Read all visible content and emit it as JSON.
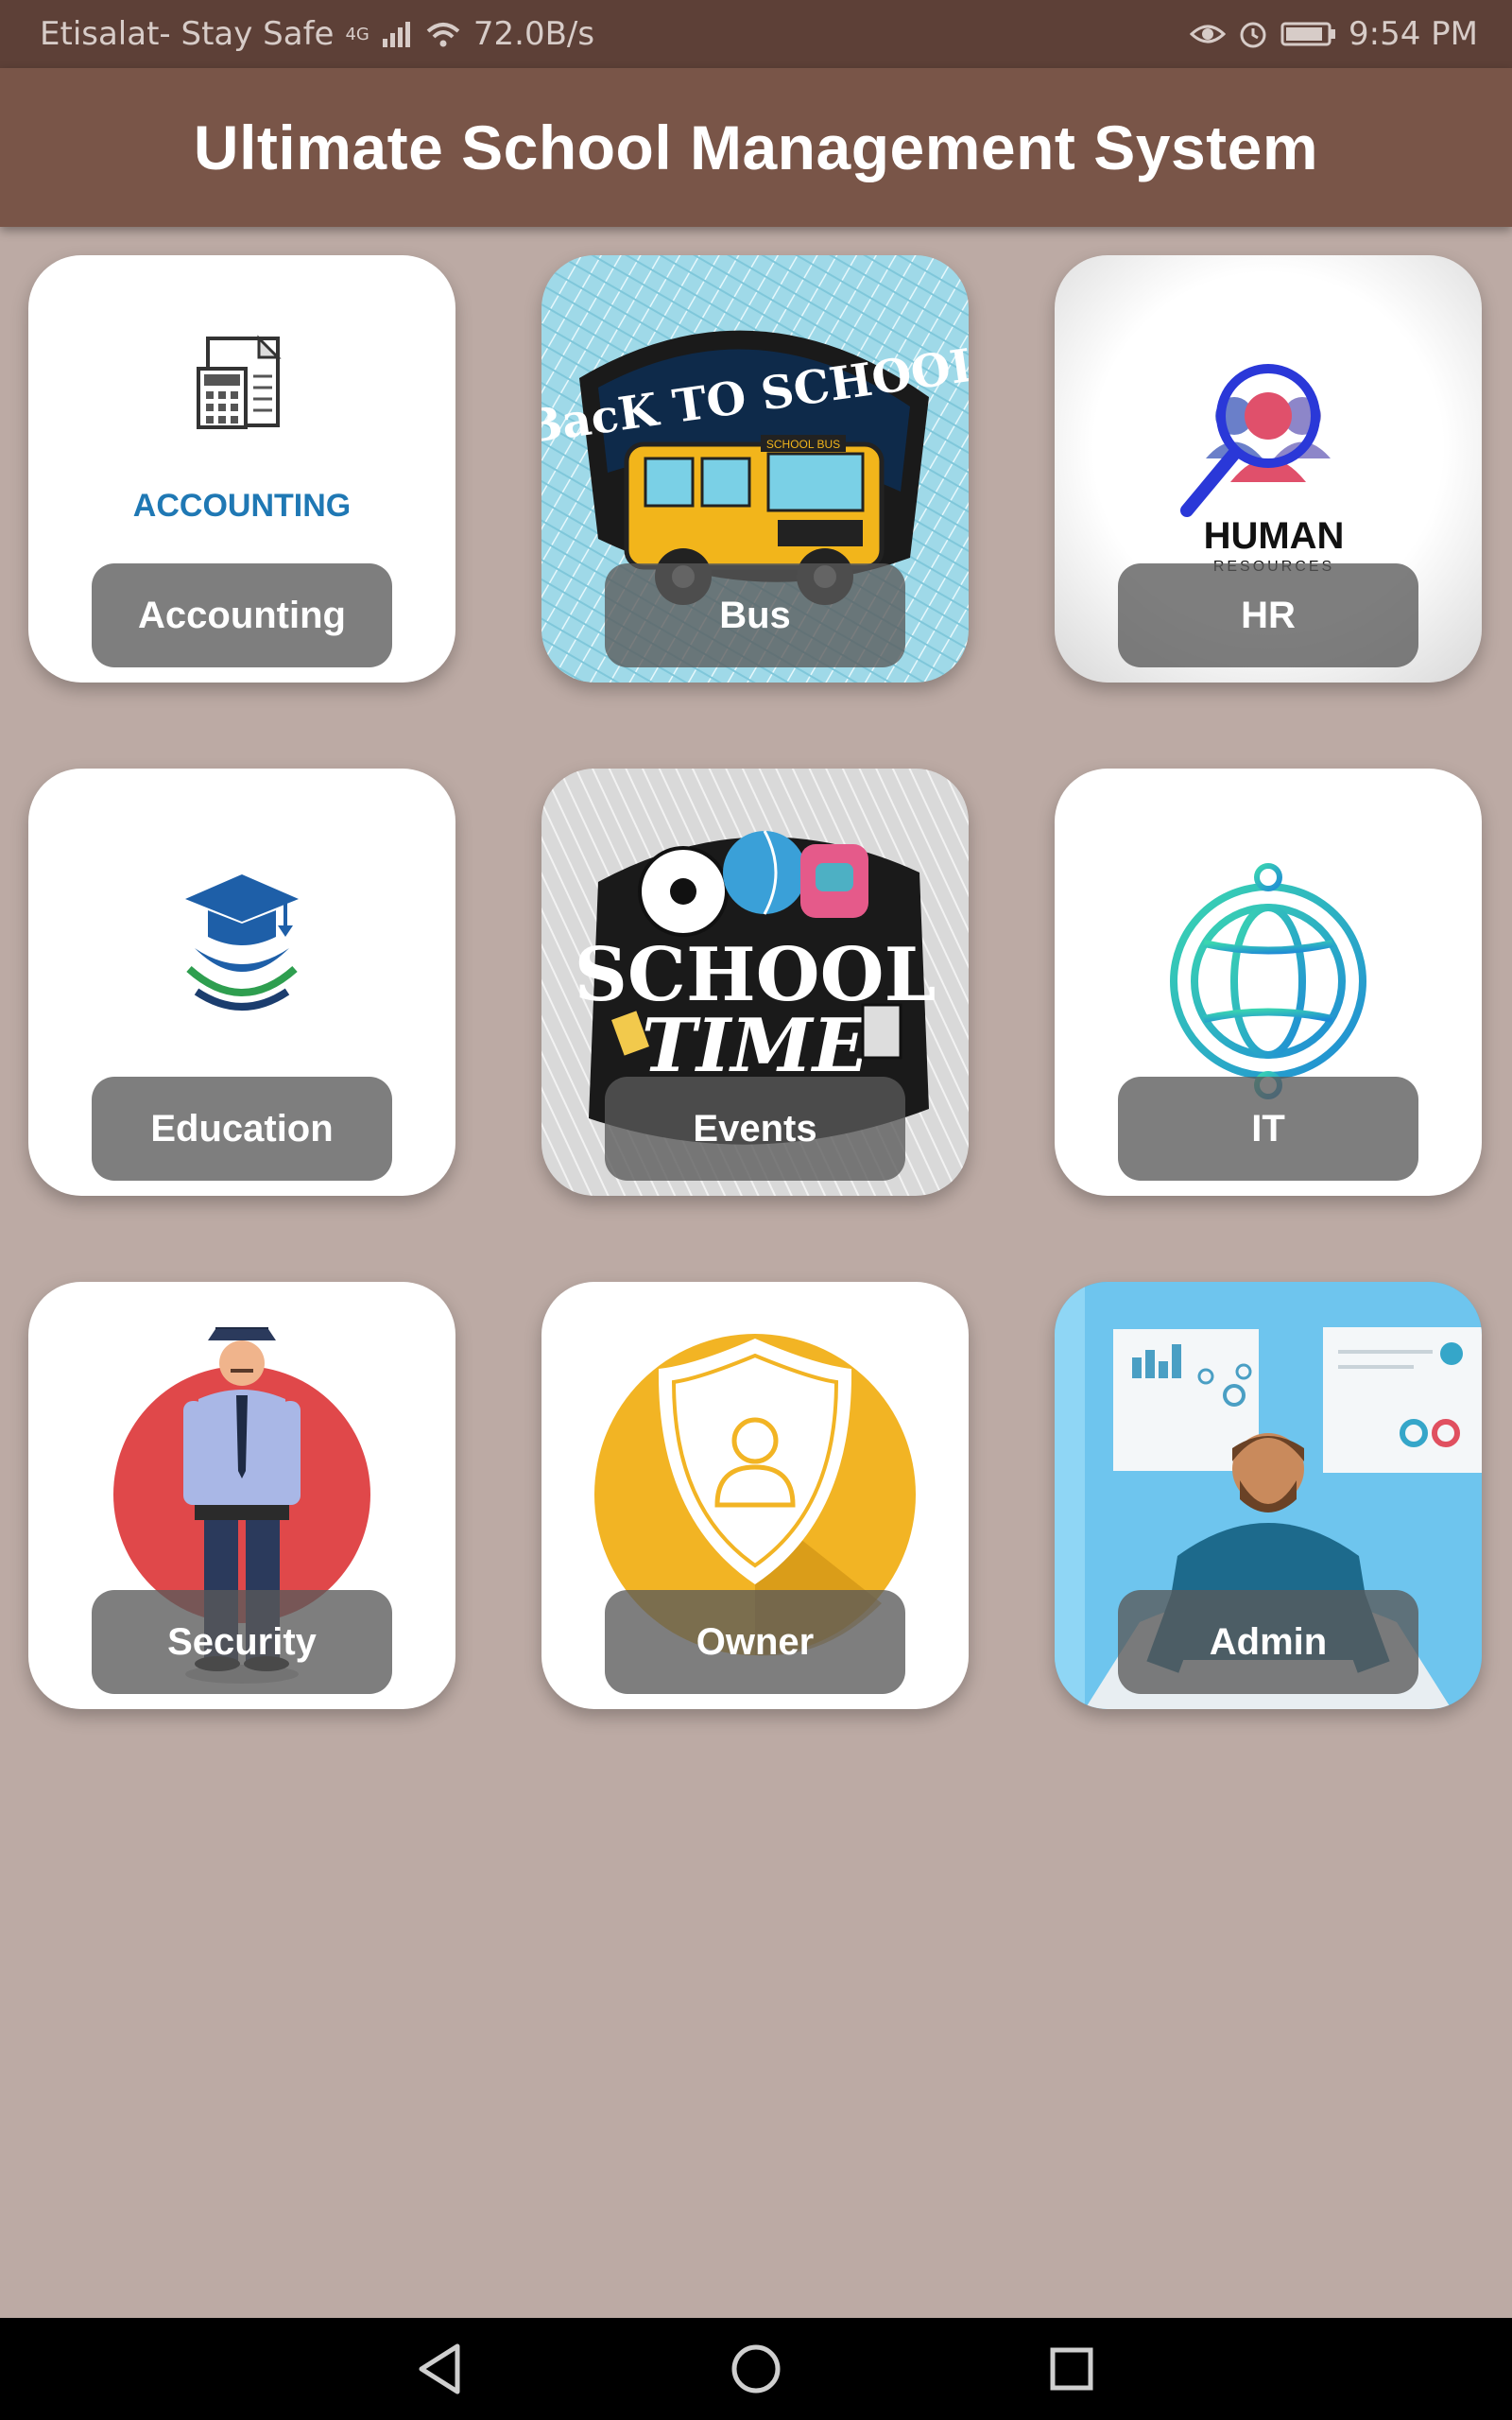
{
  "status_bar": {
    "carrier": "Etisalat- Stay Safe",
    "network": "4G",
    "speed": "72.0B/s",
    "time": "9:54 PM"
  },
  "app_bar": {
    "title": "Ultimate School Management System"
  },
  "tiles": [
    {
      "label": "Accounting",
      "art_text": "ACCOUNTING",
      "icon": "accounting-icon"
    },
    {
      "label": "Bus",
      "art_text": "BacK TO SCHOOL",
      "art_sub": "SCHOOL BUS",
      "icon": "school-bus-icon"
    },
    {
      "label": "HR",
      "art_text": "HUMAN",
      "art_sub": "RESOURCES",
      "icon": "human-resources-icon"
    },
    {
      "label": "Education",
      "icon": "graduation-cap-icon"
    },
    {
      "label": "Events",
      "art_text": "SCHOOL",
      "art_sub": "TIME",
      "icon": "school-time-icon"
    },
    {
      "label": "IT",
      "icon": "globe-icon"
    },
    {
      "label": "Security",
      "icon": "security-guard-icon"
    },
    {
      "label": "Owner",
      "icon": "owner-shield-icon"
    },
    {
      "label": "Admin",
      "icon": "admin-person-icon"
    }
  ],
  "colors": {
    "status_bar": "#5d4037",
    "app_bar": "#795548",
    "background": "#bcaaa4",
    "label_bg": "#5a5a5a"
  }
}
